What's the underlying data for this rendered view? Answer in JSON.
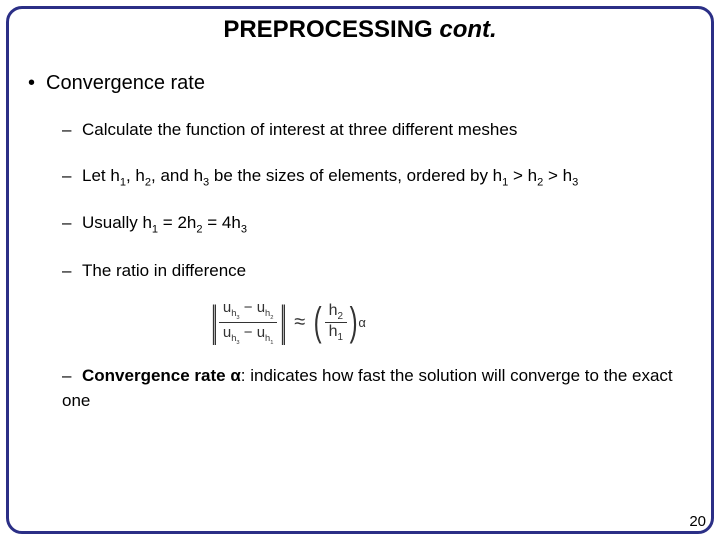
{
  "title": {
    "main": "PREPROCESSING ",
    "italic": "cont."
  },
  "bullets": {
    "lvl1": "Convergence rate",
    "b1": "Calculate the function of interest at three different meshes",
    "b2": {
      "p1": "Let h",
      "s1": "1",
      "p2": ", h",
      "s2": "2",
      "p3": ", and h",
      "s3": "3",
      "p4": " be the sizes of elements, ordered by h",
      "s4": "1",
      "p5": " > h",
      "s5": "2",
      "p6": " > h",
      "s6": "3"
    },
    "b3": {
      "p1": "Usually h",
      "s1": "1",
      "p2": " = 2h",
      "s2": "2",
      "p3": " = 4h",
      "s3": "3"
    },
    "b4": "The ratio in difference",
    "b5": {
      "bold": "Convergence rate ",
      "alpha": "α",
      "rest": ": indicates how fast the solution will converge to the exact one"
    }
  },
  "formula": {
    "norm_l": "||",
    "norm_r": "||",
    "u": "u",
    "h3": "h",
    "h3s": "3",
    "h2": "h",
    "h2s": "2",
    "h1": "h",
    "h1s": "1",
    "minus": " − ",
    "approx": "≈",
    "paren_l": "(",
    "paren_r": ")",
    "r_num": "h",
    "r_num_s": "2",
    "r_den": "h",
    "r_den_s": "1",
    "alpha": "α"
  },
  "page": "20"
}
